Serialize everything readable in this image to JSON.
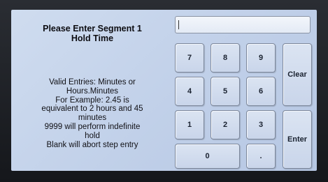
{
  "prompt": {
    "title_line1": "Please Enter Segment 1",
    "title_line2": "Hold Time",
    "info_lines": [
      "Valid Entries: Minutes or",
      "Hours.Minutes",
      "For Example: 2.45 is",
      "equivalent to 2 hours and 45",
      "minutes",
      "9999 will perform indefinite",
      "hold",
      "Blank will abort step entry"
    ]
  },
  "entry": {
    "value": ""
  },
  "keypad": {
    "k7": "7",
    "k8": "8",
    "k9": "9",
    "k4": "4",
    "k5": "5",
    "k6": "6",
    "k1": "1",
    "k2": "2",
    "k3": "3",
    "k0": "0",
    "dot": ".",
    "clear": "Clear",
    "enter": "Enter"
  }
}
